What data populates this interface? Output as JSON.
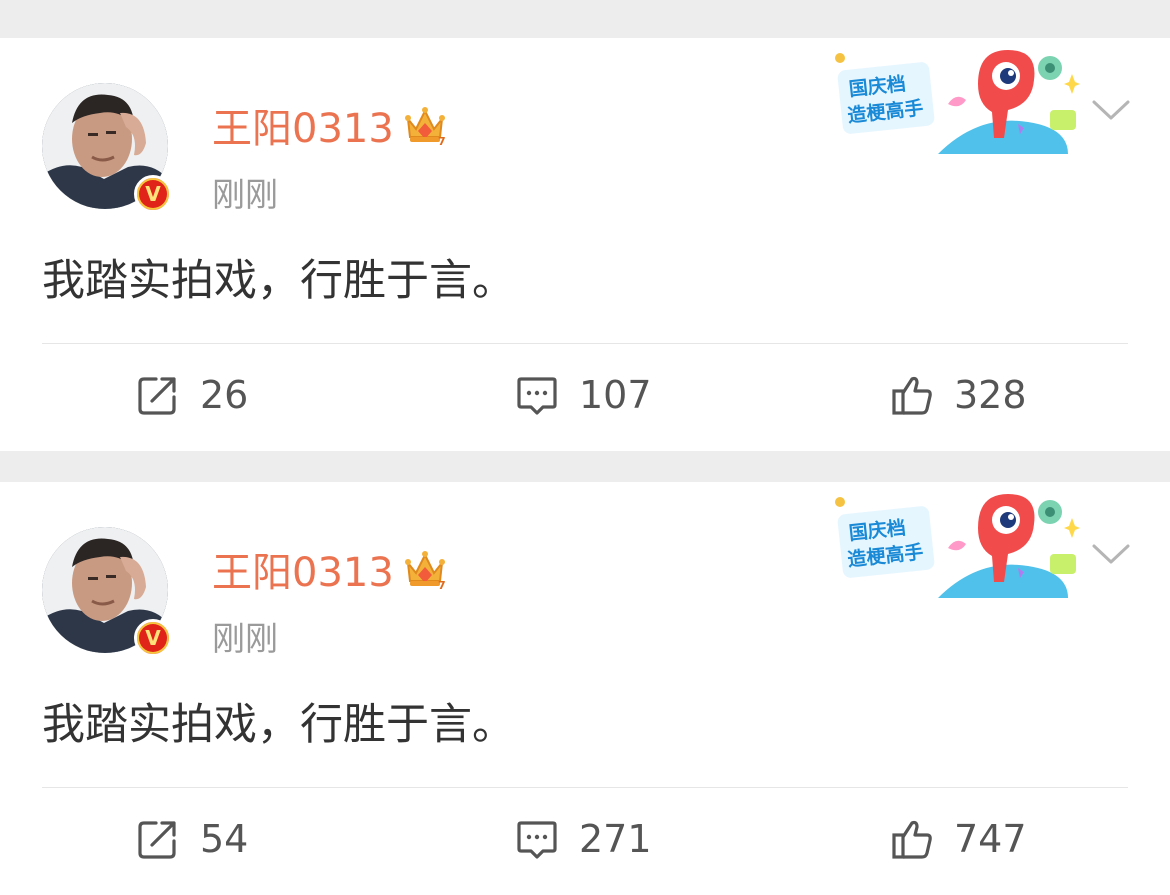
{
  "colors": {
    "background": "#ededed",
    "card": "#ffffff",
    "username": "#eb7350",
    "timestamp": "#9a9a9a",
    "text": "#333333",
    "counts": "#555555",
    "verified_badge": "#e1241a"
  },
  "decor_card": {
    "line1": "国庆档",
    "line2": "造梗高手"
  },
  "posts": [
    {
      "username": "王阳0313",
      "verified_mark": "V",
      "time": "刚刚",
      "content": "我踏实拍戏，行胜于言。",
      "reposts": "26",
      "comments": "107",
      "likes": "328"
    },
    {
      "username": "王阳0313",
      "verified_mark": "V",
      "time": "刚刚",
      "content": "我踏实拍戏，行胜于言。",
      "reposts": "54",
      "comments": "271",
      "likes": "747"
    }
  ],
  "icons": {
    "repost": "repost-icon",
    "comment": "comment-icon",
    "like": "like-icon",
    "more": "chevron-down-icon",
    "member": "crown-icon"
  }
}
